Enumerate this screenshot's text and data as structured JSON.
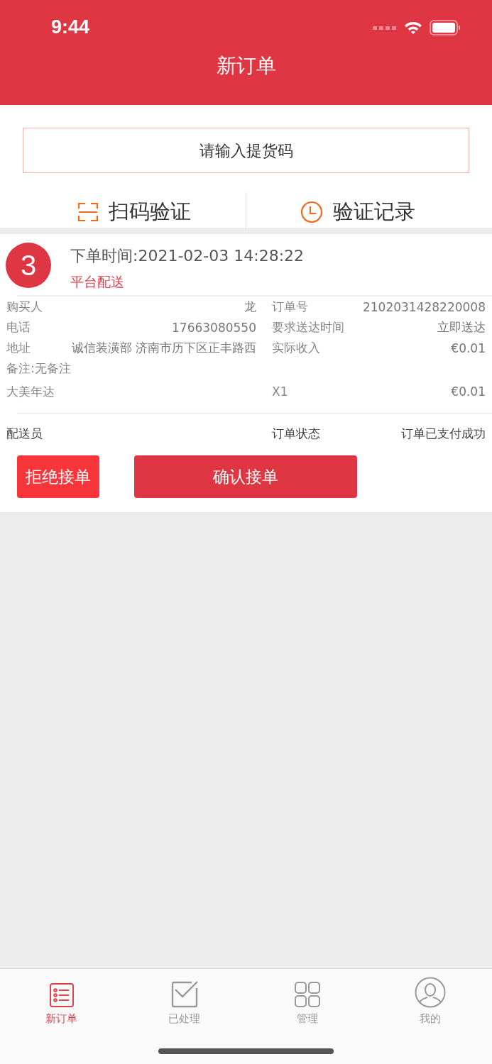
{
  "status_bar": {
    "time": "9:44"
  },
  "title": "新订单",
  "search": {
    "placeholder": "请输入提货码"
  },
  "actions": [
    {
      "kind": "scan",
      "label": "扫码验证"
    },
    {
      "kind": "history",
      "label": "验证记录"
    }
  ],
  "order": {
    "number": "3",
    "time": "下单时间:2021-02-03 14:28:22",
    "delivery": "平台配送",
    "details": [
      {
        "left": {
          "label": "购买人",
          "value": "龙"
        },
        "right": {
          "label": "订单号",
          "value": "2102031428220008"
        }
      },
      {
        "left": {
          "label": "电话",
          "value": "17663080550"
        },
        "right": {
          "label": "要求送达时间",
          "value": "立即送达"
        }
      },
      {
        "left": {
          "label": "地址",
          "value": "诚信装潢部 济南市历下区正丰路西"
        },
        "right": {
          "label": "实际收入",
          "value": "€0.01"
        }
      }
    ],
    "note": "备注:无备注",
    "items": [
      {
        "name": "大美年达",
        "quantity": "X1",
        "price": "€0.01"
      }
    ],
    "courier_label": "配送员",
    "status_label": "订单状态",
    "status": "订单已支付成功",
    "buttons": [
      {
        "kind": "reject",
        "label": "拒绝接单"
      },
      {
        "kind": "confirm",
        "label": "确认接单"
      }
    ]
  },
  "tabs": [
    {
      "kind": "orders",
      "label": "新订单",
      "selected": true
    },
    {
      "kind": "processed",
      "label": "已处理",
      "selected": false
    },
    {
      "kind": "manage",
      "label": "管理",
      "selected": false
    },
    {
      "kind": "profile",
      "label": "我的",
      "selected": false
    }
  ]
}
